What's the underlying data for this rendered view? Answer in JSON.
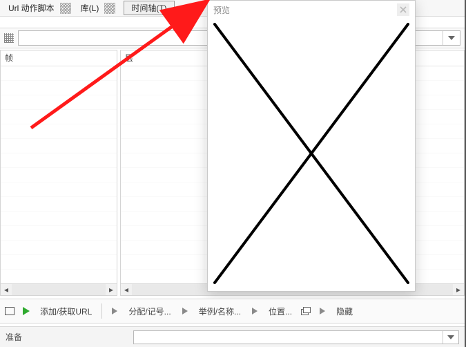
{
  "menubar": {
    "url_action_script": "Url 动作脚本",
    "library": "库(L)",
    "timeline": "时间轴(T)"
  },
  "panels": {
    "frame_header": "帧",
    "layer_header": "层"
  },
  "preview": {
    "title": "预览"
  },
  "toolbar": {
    "add_get_url": "添加/获取URL",
    "assign_note": "分配/记号...",
    "example_name": "举例/名称...",
    "position": "位置...",
    "hide": "隐藏"
  },
  "status": {
    "ready": "准备"
  },
  "icons": {
    "play": "play-icon",
    "chevron_right": "chevron-right-icon",
    "chevron_left": "chevron-left-icon",
    "chevron_down": "chevron-down-icon",
    "rect": "rect-icon",
    "stack": "stack-icon"
  }
}
